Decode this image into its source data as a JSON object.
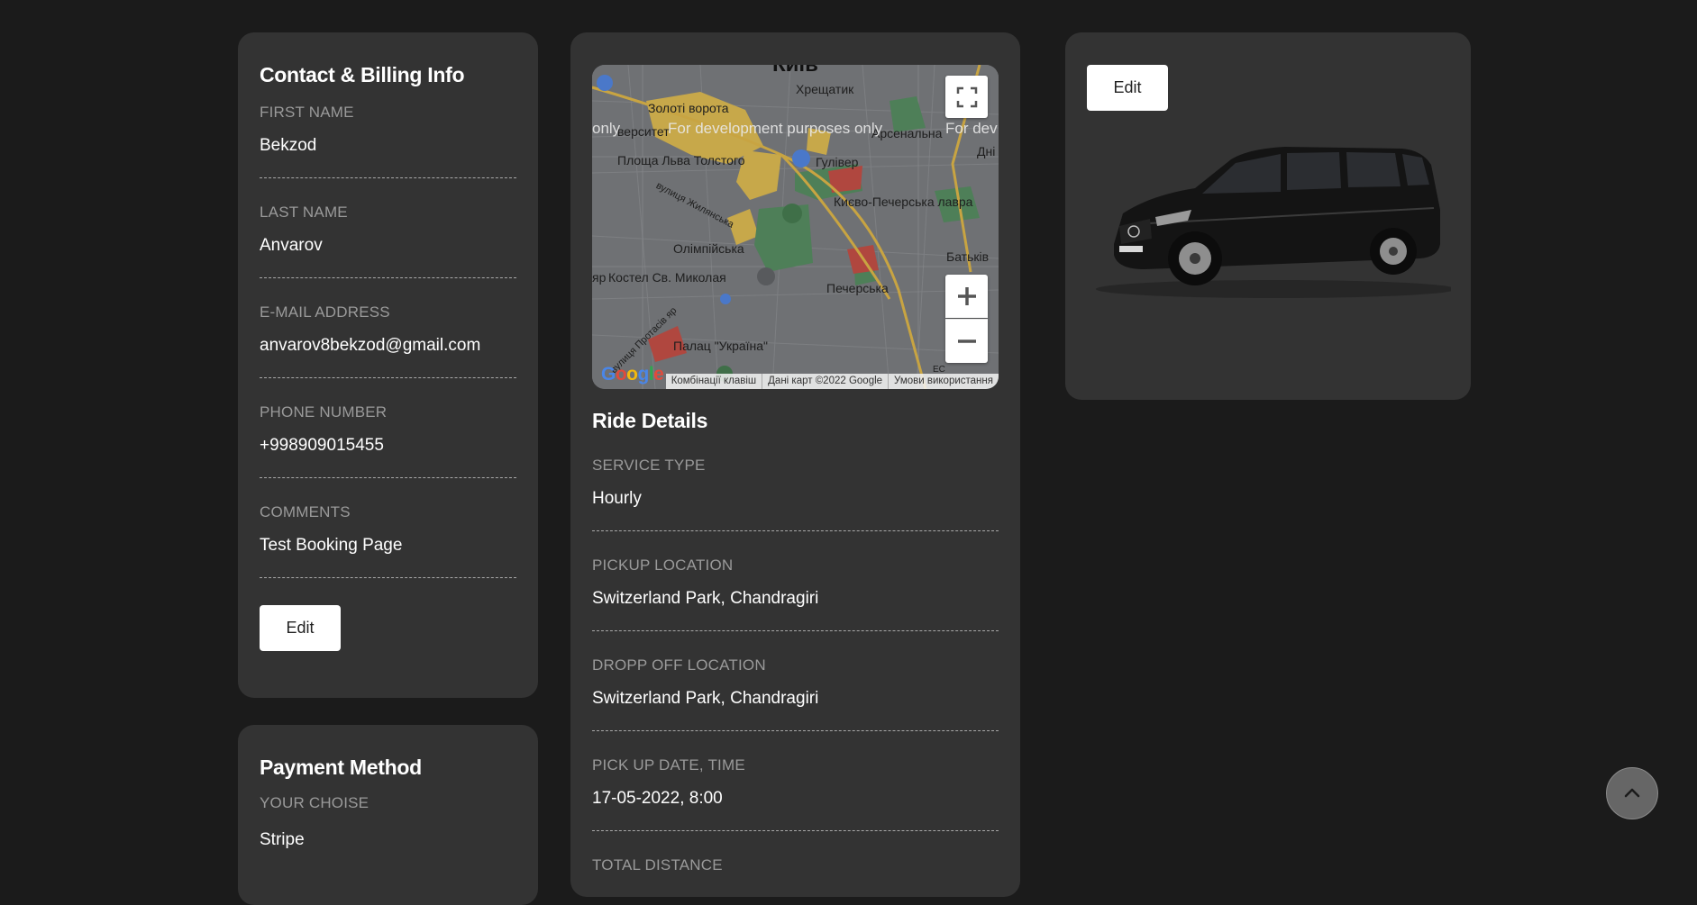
{
  "contact": {
    "title": "Contact & Billing Info",
    "fields": [
      {
        "label": "FIRST NAME",
        "value": "Bekzod"
      },
      {
        "label": "LAST NAME",
        "value": "Anvarov"
      },
      {
        "label": "E-MAIL ADDRESS",
        "value": "anvarov8bekzod@gmail.com"
      },
      {
        "label": "PHONE NUMBER",
        "value": "+998909015455"
      },
      {
        "label": "COMMENTS",
        "value": "Test Booking Page"
      }
    ],
    "edit_label": "Edit"
  },
  "payment": {
    "title": "Payment Method",
    "fields": [
      {
        "label": "YOUR CHOISE",
        "value": "Stripe"
      }
    ]
  },
  "map": {
    "city_label": "Київ",
    "dev_watermark": "For development purposes only",
    "dev_left": "only",
    "dev_right": "For dev",
    "labels": [
      "Хрещатик",
      "Золоті ворота",
      "верситет",
      "Арсенальна",
      "Дні",
      "Площа Льва Толстого",
      "Гулівер",
      "Києво-Печерська лавра",
      "вулиця Жилянська",
      "Олімпійська",
      "Батьків",
      "яр",
      "Костел Св. Миколая",
      "Печерська",
      "вулиця Протасів яр",
      "Палац \"Україна\"",
      "ЕС"
    ],
    "attribution": [
      "Комбінації клавіш",
      "Дані карт ©2022 Google",
      "Умови використання"
    ],
    "google_logo": [
      "G",
      "o",
      "o",
      "g",
      "l",
      "e"
    ],
    "icons": [
      "fullscreen-icon",
      "zoom-in-icon",
      "zoom-out-icon"
    ]
  },
  "ride": {
    "title": "Ride Details",
    "fields": [
      {
        "label": "SERVICE TYPE",
        "value": "Hourly"
      },
      {
        "label": "PICKUP LOCATION",
        "value": "Switzerland Park, Chandragiri"
      },
      {
        "label": "DROPP OFF LOCATION",
        "value": "Switzerland Park, Chandragiri"
      },
      {
        "label": "PICK UP DATE, TIME",
        "value": "17-05-2022, 8:00"
      },
      {
        "label": "TOTAL DISTANCE",
        "value": ""
      }
    ]
  },
  "vehicle": {
    "edit_label": "Edit"
  },
  "colors": {
    "page_bg": "#1b1b1b",
    "card_bg": "#333333",
    "label": "#9a9a9a",
    "button_bg": "#ffffff"
  }
}
